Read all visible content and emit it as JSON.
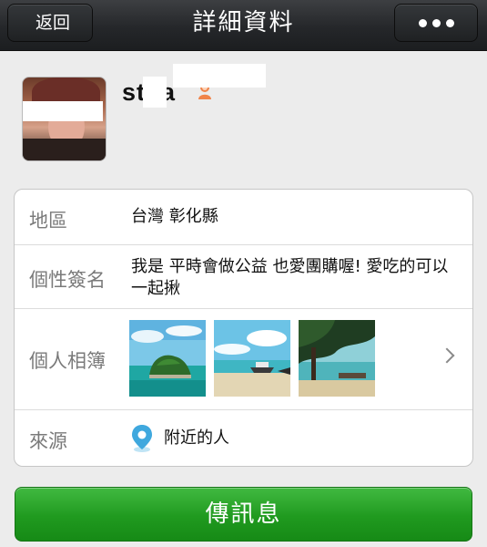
{
  "header": {
    "back_label": "返回",
    "title": "詳細資料",
    "more_icon": "more-dots-icon"
  },
  "profile": {
    "nickname": "st  la",
    "gender_icon": "female-icon",
    "gender_color": "#f0844a"
  },
  "details": {
    "region_label": "地區",
    "region_value": "台灣  彰化縣",
    "signature_label": "個性簽名",
    "signature_value": "我是                    平時會做公益  也愛團購喔! 愛吃的可以一起揪",
    "album_label": "個人相簿",
    "album_photos": [
      "island-photo",
      "beach-boat-photo",
      "tree-beach-photo"
    ],
    "source_label": "來源",
    "source_value": "附近的人",
    "source_icon": "location-pin-icon"
  },
  "actions": {
    "send_message_label": "傳訊息",
    "send_color": "#209a1f"
  }
}
